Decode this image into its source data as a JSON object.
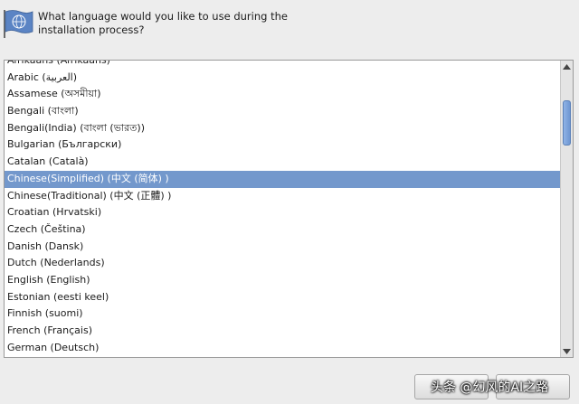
{
  "header": {
    "icon": "flag-icon",
    "prompt": "What language would you like to use during the installation process?"
  },
  "languages": [
    "Afrikaans (Afrikaans)",
    "Arabic (العربية)",
    "Assamese (অসমীয়া)",
    "Bengali (বাংলা)",
    "Bengali(India) (বাংলা (ভারত))",
    "Bulgarian (Български)",
    "Catalan (Català)",
    "Chinese(Simplified) (中文 (简体) )",
    "Chinese(Traditional) (中文 (正體) )",
    "Croatian (Hrvatski)",
    "Czech (Čeština)",
    "Danish (Dansk)",
    "Dutch (Nederlands)",
    "English (English)",
    "Estonian (eesti keel)",
    "Finnish (suomi)",
    "French (Français)",
    "German (Deutsch)"
  ],
  "selected_language": "Chinese(Simplified) (中文 (简体) )",
  "watermark": "头条 @幻风的AI之路",
  "colors": {
    "selection": "#7398cc",
    "background": "#ededed"
  }
}
